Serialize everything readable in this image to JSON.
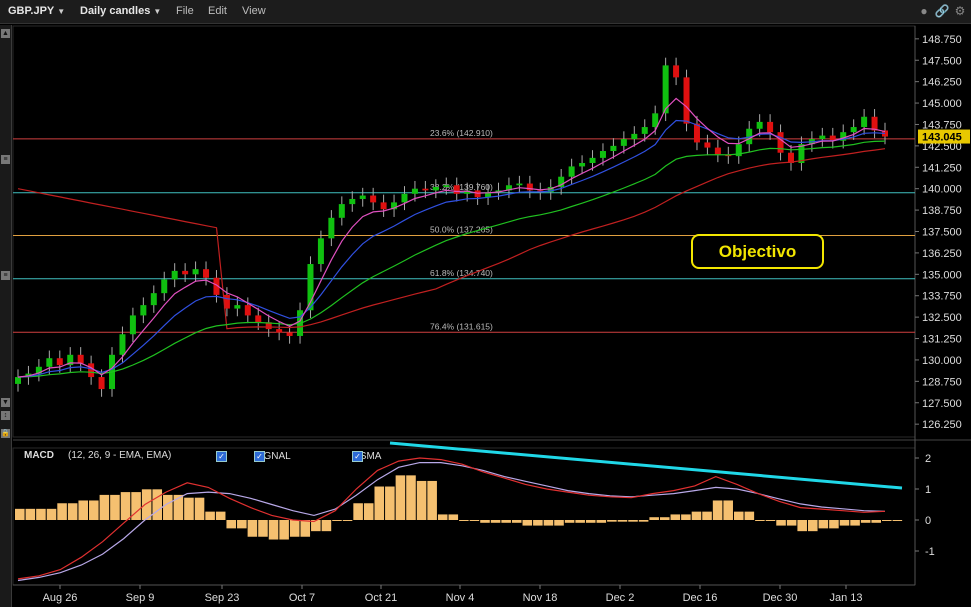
{
  "toolbar": {
    "symbol": "GBP.JPY",
    "timeframe": "Daily candles",
    "menu_file": "File",
    "menu_edit": "Edit",
    "menu_view": "View"
  },
  "price_axis": {
    "labels": [
      "148.750",
      "147.500",
      "146.250",
      "145.000",
      "143.750",
      "142.500",
      "141.250",
      "140.000",
      "138.750",
      "137.500",
      "136.250",
      "135.000",
      "133.750",
      "132.500",
      "131.250",
      "130.000",
      "128.750",
      "127.500",
      "126.250"
    ],
    "values": [
      148.75,
      147.5,
      146.25,
      145.0,
      143.75,
      142.5,
      141.25,
      140.0,
      138.75,
      137.5,
      136.25,
      135.0,
      133.75,
      132.5,
      131.25,
      130.0,
      128.75,
      127.5,
      126.25
    ],
    "last_price": "143.045",
    "last_price_value": 143.045
  },
  "fibonacci": [
    {
      "label": "23.6% (142.910)",
      "value": 142.91,
      "color": "#d04040"
    },
    {
      "label": "38.2% (139.760)",
      "value": 139.76,
      "color": "#40c0c0"
    },
    {
      "label": "50.0% (137.265)",
      "value": 137.265,
      "color": "#e0a040"
    },
    {
      "label": "61.8% (134.740)",
      "value": 134.74,
      "color": "#40c0c0"
    },
    {
      "label": "76.4% (131.615)",
      "value": 131.615,
      "color": "#d04040"
    }
  ],
  "annotation": "Objectivo",
  "macd": {
    "title": "MACD",
    "params": "(12, 26, 9 - EMA, EMA)",
    "signal_label": "SIGNAL",
    "osma_label": "OSMA",
    "axis_labels": [
      "2",
      "1",
      "0",
      "-1"
    ],
    "axis_values": [
      2,
      1,
      0,
      -1
    ],
    "macd_color": "#e03030",
    "signal_color": "#b8a8e8",
    "osma_color": "#f5c070",
    "trendline_color": "#20d8e8"
  },
  "x_axis": {
    "labels": [
      "Aug 26",
      "Sep 9",
      "Sep 23",
      "Oct 7",
      "Oct 21",
      "Nov 4",
      "Nov 18",
      "Dec 2",
      "Dec 16",
      "Dec 30",
      "Jan 13"
    ]
  },
  "colors": {
    "up_candle": "#10c010",
    "down_candle": "#e01010",
    "ma_fast": "#e050c0",
    "ma_mid": "#3050e0",
    "ma_slow": "#20c020",
    "ma_long": "#c02020"
  },
  "chart_data": {
    "type": "candlestick",
    "x_dates": [
      "Aug 26",
      "Sep 9",
      "Sep 23",
      "Oct 7",
      "Oct 21",
      "Nov 4",
      "Nov 18",
      "Dec 2",
      "Dec 16",
      "Dec 30",
      "Jan 13"
    ],
    "ylim": [
      125.5,
      149.5
    ],
    "closes": [
      129.0,
      129.2,
      129.6,
      130.1,
      129.7,
      130.3,
      129.8,
      129.0,
      128.3,
      130.3,
      131.5,
      132.6,
      133.2,
      133.9,
      134.7,
      135.2,
      135.0,
      135.3,
      134.8,
      133.8,
      133.0,
      133.2,
      132.6,
      132.2,
      131.8,
      131.6,
      131.4,
      132.9,
      135.6,
      137.1,
      138.3,
      139.1,
      139.4,
      139.6,
      139.2,
      138.8,
      139.2,
      139.7,
      140.0,
      139.9,
      140.1,
      140.2,
      139.7,
      139.9,
      139.5,
      139.8,
      139.9,
      140.2,
      140.3,
      139.9,
      139.8,
      140.1,
      140.7,
      141.3,
      141.5,
      141.8,
      142.2,
      142.5,
      142.9,
      143.2,
      143.6,
      144.4,
      147.2,
      146.5,
      143.8,
      142.7,
      142.4,
      142.0,
      141.9,
      142.6,
      143.5,
      143.9,
      143.3,
      142.1,
      141.5,
      142.6,
      142.9,
      143.1,
      142.8,
      143.3,
      143.6,
      144.2,
      143.4,
      143.045
    ],
    "macd_values": [
      -1.9,
      -1.8,
      -1.6,
      -1.2,
      -0.7,
      -0.1,
      0.5,
      0.9,
      1.2,
      1.05,
      0.7,
      0.4,
      0.15,
      0.0,
      -0.05,
      0.3,
      1.0,
      1.6,
      1.9,
      2.0,
      1.95,
      1.8,
      1.55,
      1.35,
      1.15,
      1.0,
      0.9,
      0.8,
      0.75,
      0.72,
      0.85,
      0.95,
      1.1,
      1.4,
      1.15,
      0.85,
      0.6,
      0.4,
      0.35,
      0.3,
      0.25,
      0.28
    ],
    "signal_values": [
      -1.95,
      -1.85,
      -1.7,
      -1.45,
      -1.1,
      -0.6,
      0.0,
      0.5,
      0.85,
      0.9,
      0.85,
      0.7,
      0.5,
      0.3,
      0.15,
      0.35,
      0.8,
      1.3,
      1.7,
      1.85,
      1.85,
      1.75,
      1.6,
      1.4,
      1.25,
      1.1,
      0.95,
      0.85,
      0.78,
      0.75,
      0.8,
      0.85,
      0.95,
      1.05,
      1.0,
      0.85,
      0.68,
      0.52,
      0.42,
      0.36,
      0.3,
      0.28
    ],
    "osma_values": [
      0.2,
      0.2,
      0.3,
      0.35,
      0.45,
      0.5,
      0.55,
      0.45,
      0.4,
      0.15,
      -0.15,
      -0.3,
      -0.35,
      -0.3,
      -0.2,
      0.0,
      0.3,
      0.6,
      0.8,
      0.7,
      0.1,
      0.0,
      -0.05,
      -0.05,
      -0.1,
      -0.1,
      -0.05,
      -0.05,
      -0.03,
      -0.03,
      0.05,
      0.1,
      0.15,
      0.35,
      0.15,
      0.0,
      -0.1,
      -0.2,
      -0.15,
      -0.1,
      -0.05,
      0.0
    ]
  }
}
